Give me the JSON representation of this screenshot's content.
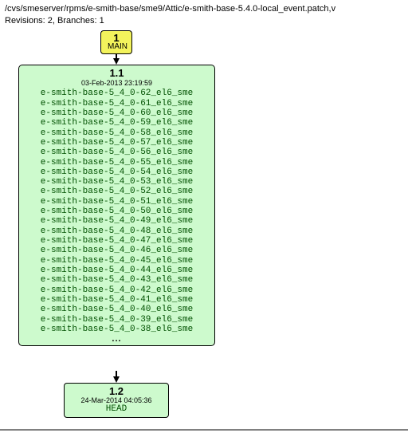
{
  "header": {
    "path": "/cvs/smeserver/rpms/e-smith-base/sme9/Attic/e-smith-base-5.4.0-local_event.patch,v",
    "stats": "Revisions: 2, Branches: 1"
  },
  "branch_node": {
    "number": "1",
    "label": "MAIN"
  },
  "rev_1_1": {
    "number": "1.1",
    "date": "03-Feb-2013 23:19:59",
    "tags": [
      "e-smith-base-5_4_0-62_el6_sme",
      "e-smith-base-5_4_0-61_el6_sme",
      "e-smith-base-5_4_0-60_el6_sme",
      "e-smith-base-5_4_0-59_el6_sme",
      "e-smith-base-5_4_0-58_el6_sme",
      "e-smith-base-5_4_0-57_el6_sme",
      "e-smith-base-5_4_0-56_el6_sme",
      "e-smith-base-5_4_0-55_el6_sme",
      "e-smith-base-5_4_0-54_el6_sme",
      "e-smith-base-5_4_0-53_el6_sme",
      "e-smith-base-5_4_0-52_el6_sme",
      "e-smith-base-5_4_0-51_el6_sme",
      "e-smith-base-5_4_0-50_el6_sme",
      "e-smith-base-5_4_0-49_el6_sme",
      "e-smith-base-5_4_0-48_el6_sme",
      "e-smith-base-5_4_0-47_el6_sme",
      "e-smith-base-5_4_0-46_el6_sme",
      "e-smith-base-5_4_0-45_el6_sme",
      "e-smith-base-5_4_0-44_el6_sme",
      "e-smith-base-5_4_0-43_el6_sme",
      "e-smith-base-5_4_0-42_el6_sme",
      "e-smith-base-5_4_0-41_el6_sme",
      "e-smith-base-5_4_0-40_el6_sme",
      "e-smith-base-5_4_0-39_el6_sme",
      "e-smith-base-5_4_0-38_el6_sme"
    ],
    "ellipsis": "..."
  },
  "rev_1_2": {
    "number": "1.2",
    "date": "24-Mar-2014 04:05:36",
    "label": "HEAD"
  }
}
